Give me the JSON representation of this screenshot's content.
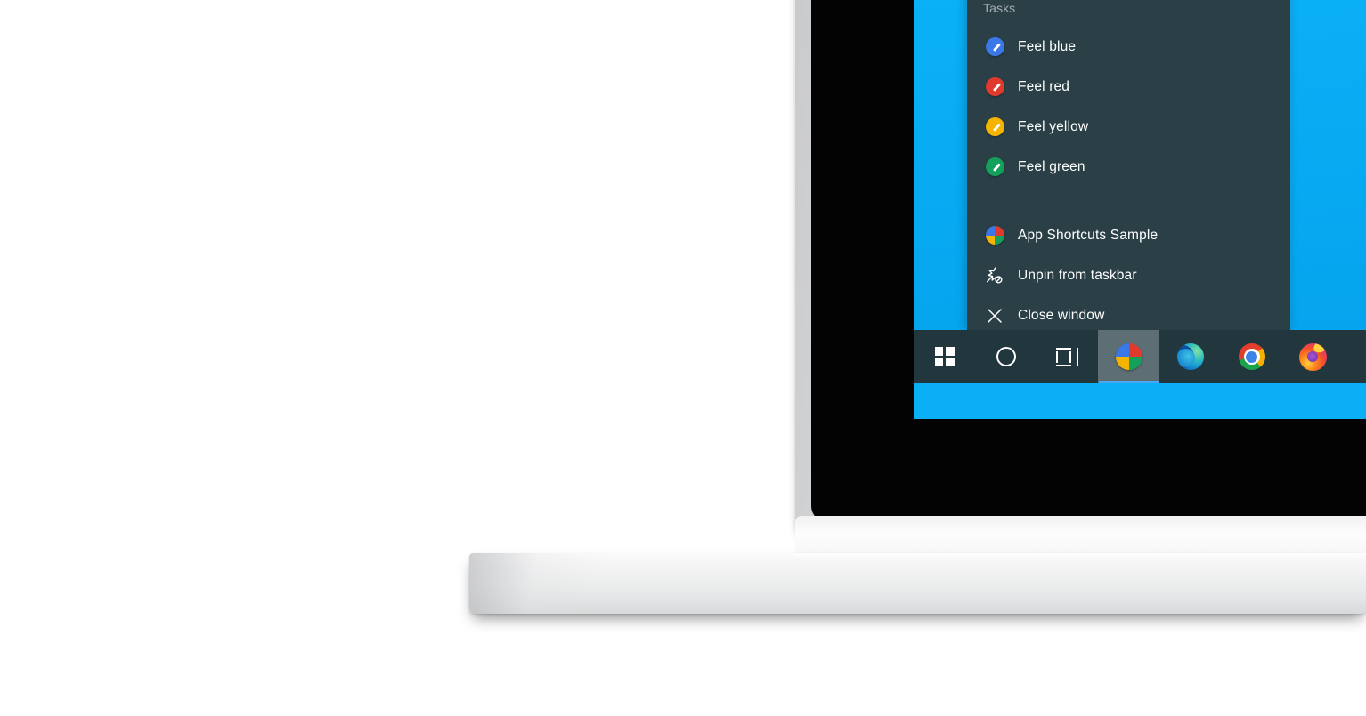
{
  "mockup": {
    "device": "laptop",
    "background_color": "#ffffff",
    "bezel_color": "#030303",
    "shell_color": "#c9cacc"
  },
  "desktop": {
    "wallpaper_color": "#0aaff5",
    "taskbar_color": "#22363e",
    "accent_color": "#47a8f5"
  },
  "jumplist": {
    "background_color": "#2b3f47",
    "header_label": "Tasks",
    "header_color": "#a6aeb2",
    "tasks": [
      {
        "label": "Feel blue",
        "icon": "pencil-icon",
        "color": "#3b78e7"
      },
      {
        "label": "Feel red",
        "icon": "pencil-icon",
        "color": "#e03a2f"
      },
      {
        "label": "Feel yellow",
        "icon": "pencil-icon",
        "color": "#f5b400"
      },
      {
        "label": "Feel green",
        "icon": "pencil-icon",
        "color": "#14a05a"
      }
    ],
    "commands": [
      {
        "label": "App Shortcuts Sample",
        "icon": "app-quad-icon"
      },
      {
        "label": "Unpin from taskbar",
        "icon": "unpin-icon"
      },
      {
        "label": "Close window",
        "icon": "close-icon"
      }
    ]
  },
  "taskbar": {
    "buttons": [
      {
        "name": "start-button",
        "icon": "windows-logo-icon",
        "active": false
      },
      {
        "name": "cortana-button",
        "icon": "cortana-circle-icon",
        "active": false
      },
      {
        "name": "task-view-button",
        "icon": "task-view-icon",
        "active": false
      },
      {
        "name": "app-shortcuts-sample-button",
        "icon": "app-quad-icon",
        "active": true
      },
      {
        "name": "edge-button",
        "icon": "edge-icon",
        "active": false
      },
      {
        "name": "chrome-button",
        "icon": "chrome-icon",
        "active": false
      },
      {
        "name": "firefox-button",
        "icon": "firefox-icon",
        "active": false
      }
    ],
    "app_icon_quadrants": {
      "top_left": "#3b78e7",
      "top_right": "#e03a2f",
      "bottom_left": "#f5b400",
      "bottom_right": "#14a05a"
    }
  }
}
